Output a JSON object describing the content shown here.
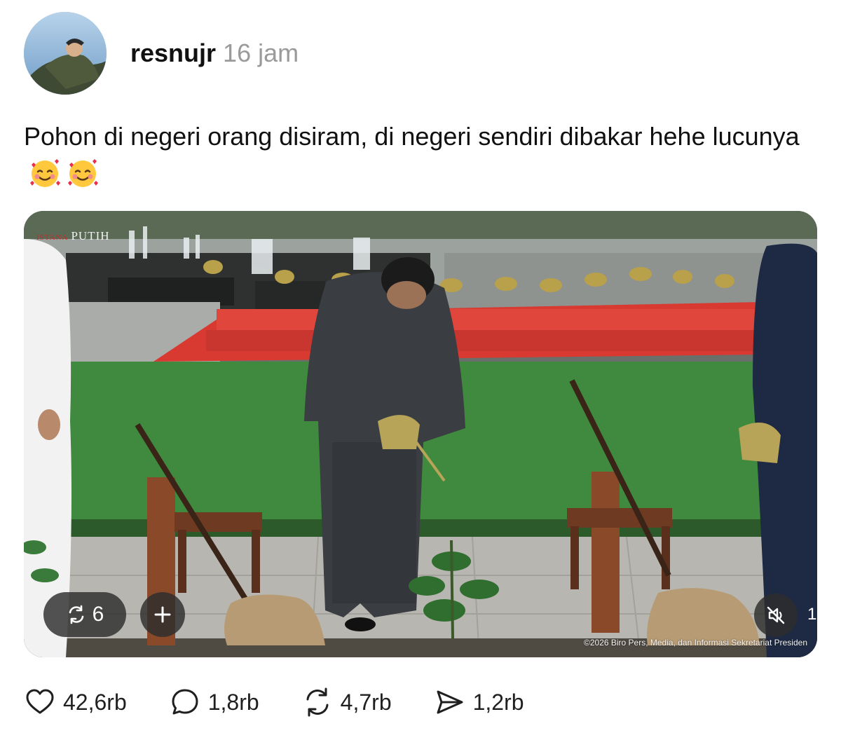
{
  "post": {
    "username": "resnujr",
    "timestamp": "16 jam",
    "caption": "Pohon di negeri orang disiram, di negeri sendiri dibakar hehe lucunya",
    "caption_emojis": [
      "smiling-face-with-hearts",
      "smiling-face-with-hearts"
    ]
  },
  "media": {
    "watermark_left": "ISTANA",
    "watermark_right": "PUTIH",
    "copyright": "©2026 Biro Pers, Media, dan Informasi Sekretariat Presiden",
    "repost_count": "6",
    "counter_peek": "1"
  },
  "actions": {
    "likes": "42,6rb",
    "comments": "1,8rb",
    "reposts": "4,7rb",
    "shares": "1,2rb"
  },
  "icons": [
    "heart-icon",
    "comment-bubble-icon",
    "repost-icon",
    "send-icon",
    "plus-icon",
    "mute-icon"
  ]
}
